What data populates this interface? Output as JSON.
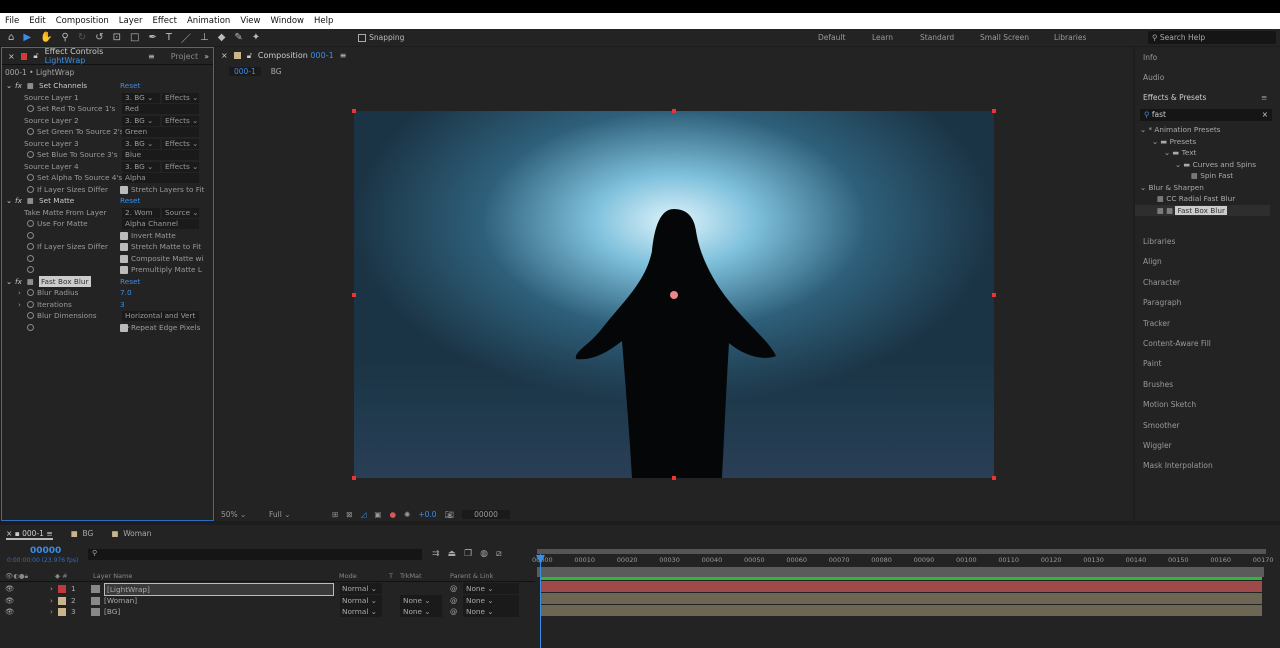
{
  "menu": [
    "File",
    "Edit",
    "Composition",
    "Layer",
    "Effect",
    "Animation",
    "View",
    "Window",
    "Help"
  ],
  "toolbar": {
    "snapping": "Snapping",
    "workspaces": [
      "Default",
      "Learn",
      "Standard",
      "Small Screen",
      "Libraries"
    ],
    "search_help": "Search Help"
  },
  "effect_controls": {
    "tab": "Effect Controls",
    "tab_layer": "LightWrap",
    "project_tab": "Project",
    "subtitle": "000-1 • LightWrap",
    "set_channels": {
      "name": "Set Channels",
      "reset": "Reset",
      "rows": [
        {
          "label": "Source Layer 1",
          "v1": "3. BG",
          "v2": "Effects"
        },
        {
          "label": "Set Red To Source 1's",
          "v": "Red"
        },
        {
          "label": "Source Layer 2",
          "v1": "3. BG",
          "v2": "Effects"
        },
        {
          "label": "Set Green To Source 2's",
          "v": "Green"
        },
        {
          "label": "Source Layer 3",
          "v1": "3. BG",
          "v2": "Effects"
        },
        {
          "label": "Set Blue To Source 3's",
          "v": "Blue"
        },
        {
          "label": "Source Layer 4",
          "v1": "3. BG",
          "v2": "Effects"
        },
        {
          "label": "Set Alpha To Source 4's",
          "v": "Alpha"
        },
        {
          "label": "If Layer Sizes Differ",
          "check": "Stretch Layers to Fit"
        }
      ]
    },
    "set_matte": {
      "name": "Set Matte",
      "reset": "Reset",
      "take_label": "Take Matte From Layer",
      "take_v1": "2. Wom",
      "take_v2": "Source",
      "use_label": "Use For Matte",
      "use_v": "Alpha Channel",
      "invert": "Invert Matte",
      "if_label": "If Layer Sizes Differ",
      "stretch": "Stretch Matte to Fit",
      "composite": "Composite Matte wi",
      "premultiply": "Premultiply Matte L"
    },
    "fast_box_blur": {
      "name": "Fast Box Blur",
      "reset": "Reset",
      "radius_label": "Blur Radius",
      "radius": "7.0",
      "iter_label": "Iterations",
      "iter": "3",
      "dim_label": "Blur Dimensions",
      "dim": "Horizontal and Vert",
      "repeat": "Repeat Edge Pixels"
    }
  },
  "composition": {
    "tab": "Composition",
    "name": "000-1",
    "crumb1": "000-1",
    "crumb2": "BG",
    "zoom": "50%",
    "resolution": "Full",
    "exposure": "+0.0",
    "timecode": "00000"
  },
  "right_panel": {
    "info": "Info",
    "audio": "Audio",
    "effects_presets": "Effects & Presets",
    "search": "fast",
    "tree": [
      "* Animation Presets",
      "Presets",
      "Text",
      "Curves and Spins",
      "Spin Fast",
      "Blur & Sharpen",
      "CC Radial Fast Blur",
      "Fast Box Blur"
    ],
    "panels": [
      "Libraries",
      "Align",
      "Character",
      "Paragraph",
      "Tracker",
      "Content-Aware Fill",
      "Paint",
      "Brushes",
      "Motion Sketch",
      "Smoother",
      "Wiggler",
      "Mask Interpolation"
    ]
  },
  "timeline": {
    "tabs": [
      "000-1",
      "BG",
      "Woman"
    ],
    "frame": "00000",
    "timecode": "0:00:00:00 (23.976 fps)",
    "headers": {
      "name": "Layer Name",
      "mode": "Mode",
      "t": "T",
      "trkmat": "TrkMat",
      "parent": "Parent & Link"
    },
    "layers": [
      {
        "num": "1",
        "name": "[LightWrap]",
        "mode": "Normal",
        "trkmat": "",
        "parent": "None",
        "color": "#c0393b"
      },
      {
        "num": "2",
        "name": "[Woman]",
        "mode": "Normal",
        "trkmat": "None",
        "parent": "None",
        "color": "#c9b48c"
      },
      {
        "num": "3",
        "name": "[BG]",
        "mode": "Normal",
        "trkmat": "None",
        "parent": "None",
        "color": "#c9b48c"
      }
    ],
    "ticks": [
      "00000",
      "00010",
      "00020",
      "00030",
      "00040",
      "00050",
      "00060",
      "00070",
      "00080",
      "00090",
      "00100",
      "00110",
      "00120",
      "00130",
      "00140",
      "00150",
      "00160",
      "00170"
    ]
  }
}
